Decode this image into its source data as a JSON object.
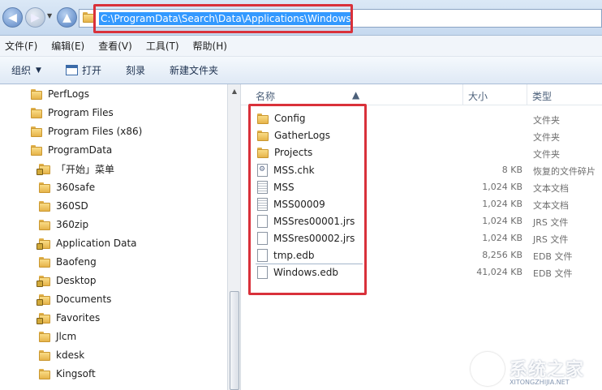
{
  "address": {
    "path": "C:\\ProgramData\\Search\\Data\\Applications\\Windows"
  },
  "menu": [
    "文件(F)",
    "编辑(E)",
    "查看(V)",
    "工具(T)",
    "帮助(H)"
  ],
  "toolbar": {
    "organize": "组织",
    "open": "打开",
    "burn": "刻录",
    "new_folder": "新建文件夹"
  },
  "nav_items": [
    {
      "label": "PerfLogs",
      "lock": false
    },
    {
      "label": "Program Files",
      "lock": false
    },
    {
      "label": "Program Files (x86)",
      "lock": false
    },
    {
      "label": "ProgramData",
      "lock": false
    },
    {
      "label": "「开始」菜单",
      "lock": true
    },
    {
      "label": "360safe",
      "lock": false
    },
    {
      "label": "360SD",
      "lock": false
    },
    {
      "label": "360zip",
      "lock": false
    },
    {
      "label": "Application Data",
      "lock": true
    },
    {
      "label": "Baofeng",
      "lock": false
    },
    {
      "label": "Desktop",
      "lock": true
    },
    {
      "label": "Documents",
      "lock": true
    },
    {
      "label": "Favorites",
      "lock": true
    },
    {
      "label": "Jlcm",
      "lock": false
    },
    {
      "label": "kdesk",
      "lock": false
    },
    {
      "label": "Kingsoft",
      "lock": false
    }
  ],
  "columns": {
    "name": "名称",
    "size": "大小",
    "type": "类型"
  },
  "files": [
    {
      "name": "Config",
      "size": "",
      "type": "文件夹",
      "kind": "folder"
    },
    {
      "name": "GatherLogs",
      "size": "",
      "type": "文件夹",
      "kind": "folder"
    },
    {
      "name": "Projects",
      "size": "",
      "type": "文件夹",
      "kind": "folder"
    },
    {
      "name": "MSS.chk",
      "size": "8 KB",
      "type": "恢复的文件碎片",
      "kind": "chk"
    },
    {
      "name": "MSS",
      "size": "1,024 KB",
      "type": "文本文档",
      "kind": "txt"
    },
    {
      "name": "MSS00009",
      "size": "1,024 KB",
      "type": "文本文档",
      "kind": "txt"
    },
    {
      "name": "MSSres00001.jrs",
      "size": "1,024 KB",
      "type": "JRS 文件",
      "kind": "file"
    },
    {
      "name": "MSSres00002.jrs",
      "size": "1,024 KB",
      "type": "JRS 文件",
      "kind": "file"
    },
    {
      "name": "tmp.edb",
      "size": "8,256 KB",
      "type": "EDB 文件",
      "kind": "file"
    },
    {
      "name": "Windows.edb",
      "size": "41,024 KB",
      "type": "EDB 文件",
      "kind": "file"
    }
  ],
  "watermark": {
    "text": "系统之家",
    "url": "XITONGZHIJIA.NET"
  }
}
